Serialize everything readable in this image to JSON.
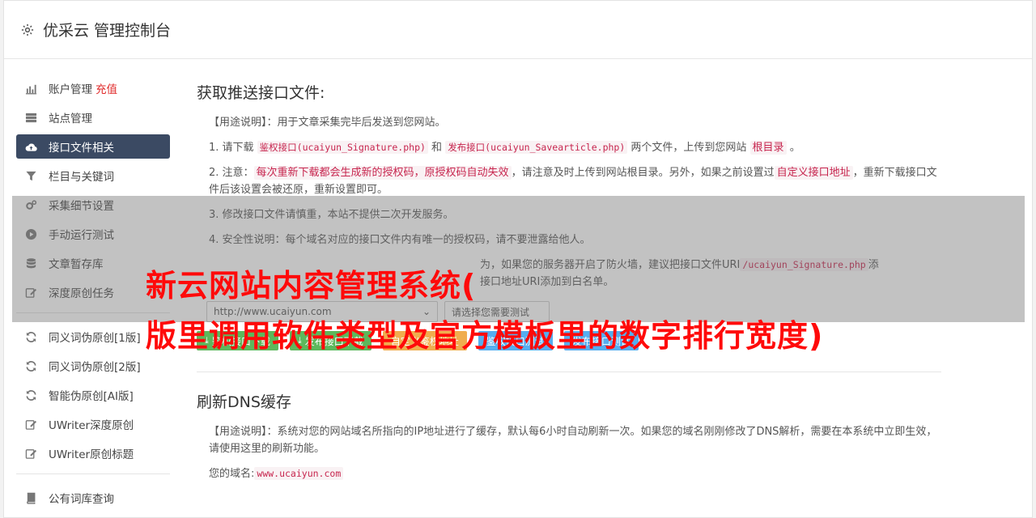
{
  "header": {
    "title": "优采云 管理控制台"
  },
  "sidebar": {
    "group1": [
      {
        "label": "账户管理",
        "extra": "充值",
        "icon": "bar-chart-icon"
      },
      {
        "label": "站点管理",
        "icon": "server-icon"
      },
      {
        "label": "接口文件相关",
        "icon": "cloud-upload-icon",
        "active": true
      },
      {
        "label": "栏目与关键词",
        "icon": "filter-icon"
      },
      {
        "label": "采集细节设置",
        "icon": "cogs-icon"
      },
      {
        "label": "手动运行测试",
        "icon": "play-circle-icon"
      },
      {
        "label": "文章暂存库",
        "icon": "database-icon"
      },
      {
        "label": "深度原创任务",
        "icon": "edit-icon"
      }
    ],
    "group2": [
      {
        "label": "同义词伪原创[1版]",
        "icon": "refresh-icon"
      },
      {
        "label": "同义词伪原创[2版]",
        "icon": "refresh-icon"
      },
      {
        "label": "智能伪原创[AI版]",
        "icon": "refresh-icon"
      },
      {
        "label": "UWriter深度原创",
        "icon": "edit-icon"
      },
      {
        "label": "UWriter原创标题",
        "icon": "edit-icon"
      }
    ],
    "group3": [
      {
        "label": "公有词库查询",
        "icon": "book-icon"
      }
    ]
  },
  "section1": {
    "title": "获取推送接口文件:",
    "usage": "【用途说明】：用于文章采集完毕后发送到您网站。",
    "step1": {
      "prefix": "1. 请下载 ",
      "link1": "鉴权接口(ucaiyun_Signature.php)",
      "and": " 和 ",
      "link2": "发布接口(ucaiyun_Savearticle.php)",
      "middle": " 两个文件，上传到您网站 ",
      "root": "根目录",
      "suffix": " 。"
    },
    "step2": {
      "prefix": "2. 注意：",
      "warn": "每次重新下载都会生成新的授权码，原授权码自动失效",
      "middle": "，请注意及时上传到网站根目录。另外，如果之前设置过",
      "custom": "自定义接口地址",
      "suffix": "，重新下载接口文件后该设置会被还原，重新设置即可。"
    },
    "step3": "3. 修改接口文件请慎重，本站不提供二次开发服务。",
    "step4": "4. 安全性说明：每个域名对应的接口文件内有唯一的授权码，请不要泄露给他人。",
    "step5": {
      "text": "为，如果您的服务器开启了防火墙，建议把接口文件URI",
      "path": "/ucaiyun_Signature.php",
      "suffix": "添",
      "line2": "接口地址URI添加到白名单。"
    },
    "select1": "http://www.ucaiyun.com",
    "select2": "请选择您需要测试",
    "buttons": {
      "auth_download": "鉴权接口下载",
      "publish_download": "发布接口下载",
      "custom_auth": "自定义鉴权地址",
      "auth_test": "鉴权接口测试",
      "publish_test": "发布接口测试"
    }
  },
  "section2": {
    "title": "刷新DNS缓存",
    "usage": "【用途说明】：系统对您的网站域名所指向的IP地址进行了缓存，默认每6小时自动刷新一次。如果您的域名刚刚修改了DNS解析，需要在本系统中立即生效，请使用这里的刷新功能。",
    "domain_label": "您的域名:",
    "domain_value": "www.ucaiyun.com"
  },
  "overlay": {
    "line1": "新云网站内容管理系统(",
    "line2": "版里调用软件类型及官方模板里的数字排行宽度)"
  },
  "colors": {
    "active_nav": "#3b4a63",
    "green": "#5cb85c",
    "orange": "#f0ad4e",
    "blue": "#55aef0",
    "overlay_text": "#ff0a0a"
  }
}
